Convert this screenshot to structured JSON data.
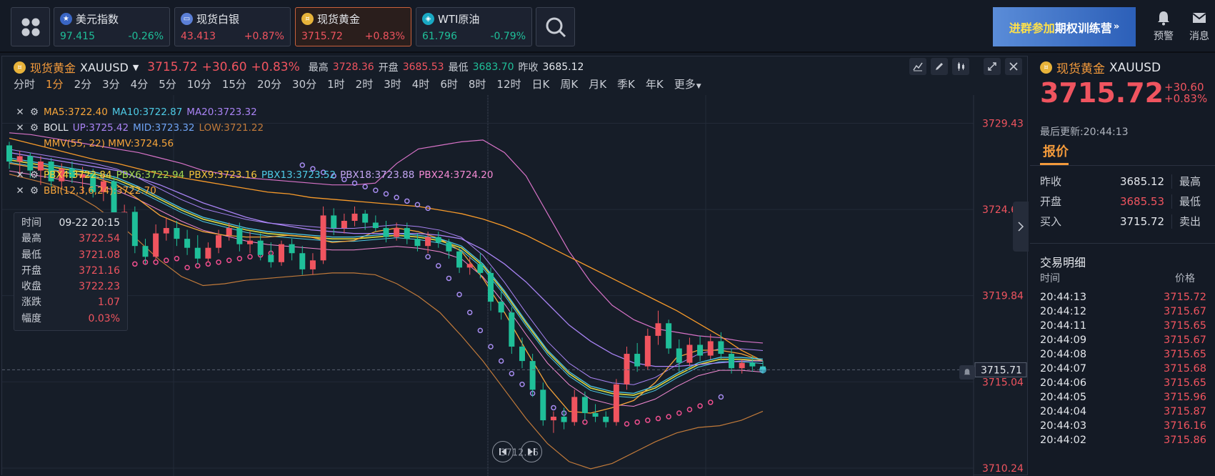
{
  "topbar": {
    "quotes": [
      {
        "name": "美元指数",
        "price": "97.415",
        "change": "-0.26%",
        "price_color": "#1fbf99",
        "change_color": "#1fbf99",
        "icon": "us-flag-icon"
      },
      {
        "name": "现货白银",
        "price": "43.413",
        "change": "+0.87%",
        "price_color": "#f0545f",
        "change_color": "#f0545f",
        "icon": "silver-bar-icon"
      },
      {
        "name": "现货黄金",
        "price": "3715.72",
        "change": "+0.83%",
        "price_color": "#f0545f",
        "change_color": "#f0545f",
        "icon": "gold-coin-icon"
      },
      {
        "name": "WTI原油",
        "price": "61.796",
        "change": "-0.79%",
        "price_color": "#1fbf99",
        "change_color": "#1fbf99",
        "icon": "oil-drum-icon"
      }
    ],
    "banner_part1": "进群参加",
    "banner_part2": "期权训练营",
    "banner_arrow": "»",
    "alert_label": "预警",
    "message_label": "消息"
  },
  "chart_header": {
    "name": "现货黄金",
    "symbol": "XAUUSD",
    "price": "3715.72",
    "change": "+30.60",
    "change_pct": "+0.83%",
    "high_label": "最高",
    "high": "3728.36",
    "open_label": "开盘",
    "open": "3685.53",
    "low_label": "最低",
    "low": "3683.70",
    "prev_label": "昨收",
    "prev": "3685.12"
  },
  "periods": [
    "分时",
    "1分",
    "2分",
    "3分",
    "4分",
    "5分",
    "10分",
    "15分",
    "20分",
    "30分",
    "1时",
    "2时",
    "3时",
    "4时",
    "6时",
    "8时",
    "12时",
    "日K",
    "周K",
    "月K",
    "季K",
    "年K",
    "更多"
  ],
  "active_period": "1分",
  "indicators": {
    "ma5": "MA5:3722.40",
    "ma10": "MA10:3722.87",
    "ma20": "MA20:3723.32",
    "boll": "BOLL",
    "boll_up": "UP:3725.42",
    "boll_mid": "MID:3723.32",
    "boll_low": "LOW:3721.22",
    "mmv": "MMV(55, 22) MMV:3724.56",
    "pbx4": "PBX4:3722.84",
    "pbx6": "PBX6:3722.94",
    "pbx9": "PBX9:3723.16",
    "pbx13": "PBX13:3723.52",
    "pbx18": "PBX18:3723.88",
    "pbx24": "PBX24:3724.20",
    "bbi": "BBI(12,3,6,24):3722.70"
  },
  "tooltip": {
    "time_label": "时间",
    "time": "09-22 20:15",
    "high_label": "最高",
    "high": "3722.54",
    "low_label": "最低",
    "low": "3721.08",
    "open_label": "开盘",
    "open": "3721.16",
    "close_label": "收盘",
    "close": "3722.23",
    "change_label": "涨跌",
    "change": "1.07",
    "amp_label": "幅度",
    "amp": "0.03%"
  },
  "chart_data": {
    "type": "candlestick",
    "y_axis_labels": [
      "3729.43",
      "3724.63",
      "3719.84",
      "3715.04",
      "3710.24"
    ],
    "ylim": [
      3709.8,
      3731.0
    ],
    "current_price_label": "3715.71",
    "min_label": "3712.16",
    "candles": [
      [
        3728.2,
        3728.4,
        3726.9,
        3727.3
      ],
      [
        3727.3,
        3727.9,
        3726.5,
        3727.6
      ],
      [
        3727.6,
        3727.8,
        3726.4,
        3726.8
      ],
      [
        3726.8,
        3727.6,
        3726.0,
        3727.3
      ],
      [
        3727.3,
        3727.5,
        3725.9,
        3726.2
      ],
      [
        3726.2,
        3727.2,
        3725.8,
        3726.9
      ],
      [
        3726.9,
        3727.3,
        3726.1,
        3726.4
      ],
      [
        3726.4,
        3727.0,
        3725.5,
        3726.6
      ],
      [
        3726.6,
        3726.9,
        3725.3,
        3725.6
      ],
      [
        3725.6,
        3726.6,
        3725.1,
        3726.2
      ],
      [
        3726.2,
        3726.5,
        3722.6,
        3723.1
      ],
      [
        3723.1,
        3724.9,
        3722.4,
        3724.5
      ],
      [
        3724.5,
        3724.8,
        3722.2,
        3722.6
      ],
      [
        3722.6,
        3723.0,
        3721.6,
        3722.0
      ],
      [
        3722.0,
        3723.8,
        3721.8,
        3723.3
      ],
      [
        3723.3,
        3724.2,
        3722.9,
        3723.6
      ],
      [
        3723.6,
        3724.0,
        3722.6,
        3723.0
      ],
      [
        3723.0,
        3723.5,
        3722.1,
        3722.5
      ],
      [
        3722.5,
        3723.2,
        3721.6,
        3721.9
      ],
      [
        3721.9,
        3722.8,
        3721.7,
        3722.5
      ],
      [
        3722.5,
        3723.5,
        3722.2,
        3723.2
      ],
      [
        3723.2,
        3723.9,
        3722.9,
        3723.6
      ],
      [
        3723.6,
        3723.9,
        3722.3,
        3722.7
      ],
      [
        3722.7,
        3723.4,
        3722.2,
        3722.9
      ],
      [
        3722.9,
        3723.3,
        3721.8,
        3722.1
      ],
      [
        3722.1,
        3722.8,
        3721.4,
        3721.7
      ],
      [
        3721.7,
        3722.9,
        3721.5,
        3722.7
      ],
      [
        3722.7,
        3723.0,
        3721.8,
        3722.2
      ],
      [
        3722.2,
        3722.6,
        3721.0,
        3721.3
      ],
      [
        3721.3,
        3722.2,
        3721.0,
        3721.8
      ],
      [
        3721.8,
        3724.8,
        3721.6,
        3724.3
      ],
      [
        3724.3,
        3724.7,
        3723.2,
        3723.6
      ],
      [
        3723.6,
        3724.4,
        3723.3,
        3724.0
      ],
      [
        3724.0,
        3724.8,
        3723.7,
        3724.4
      ],
      [
        3724.4,
        3724.6,
        3723.5,
        3723.9
      ],
      [
        3723.9,
        3724.3,
        3723.4,
        3723.6
      ],
      [
        3723.6,
        3724.0,
        3722.8,
        3723.1
      ],
      [
        3723.1,
        3723.9,
        3722.9,
        3723.6
      ],
      [
        3723.6,
        3723.9,
        3722.7,
        3723.0
      ],
      [
        3723.0,
        3723.3,
        3722.3,
        3722.6
      ],
      [
        3722.6,
        3723.4,
        3722.2,
        3723.1
      ],
      [
        3723.1,
        3723.4,
        3722.5,
        3722.8
      ],
      [
        3722.8,
        3723.0,
        3721.9,
        3722.3
      ],
      [
        3722.3,
        3722.5,
        3721.1,
        3721.4
      ],
      [
        3721.4,
        3722.0,
        3721.0,
        3721.6
      ],
      [
        3721.6,
        3722.2,
        3720.8,
        3721.1
      ],
      [
        3721.1,
        3721.4,
        3719.0,
        3719.5
      ],
      [
        3719.5,
        3720.2,
        3718.5,
        3718.9
      ],
      [
        3718.9,
        3719.2,
        3716.6,
        3717.0
      ],
      [
        3717.0,
        3717.5,
        3715.8,
        3716.2
      ],
      [
        3716.2,
        3716.6,
        3714.2,
        3714.6
      ],
      [
        3714.6,
        3715.0,
        3712.6,
        3712.9
      ],
      [
        3712.9,
        3713.4,
        3712.2,
        3713.1
      ],
      [
        3713.1,
        3713.6,
        3712.4,
        3712.8
      ],
      [
        3712.8,
        3714.6,
        3712.6,
        3714.2
      ],
      [
        3714.2,
        3714.5,
        3712.9,
        3713.3
      ],
      [
        3713.3,
        3713.8,
        3712.8,
        3713.1
      ],
      [
        3713.1,
        3713.4,
        3712.5,
        3712.8
      ],
      [
        3712.8,
        3715.2,
        3712.6,
        3714.9
      ],
      [
        3714.9,
        3717.0,
        3714.6,
        3716.6
      ],
      [
        3716.6,
        3717.2,
        3715.6,
        3715.9
      ],
      [
        3715.9,
        3718.0,
        3715.7,
        3717.6
      ],
      [
        3717.6,
        3719.0,
        3717.1,
        3718.3
      ],
      [
        3718.3,
        3718.5,
        3716.6,
        3716.9
      ],
      [
        3716.9,
        3717.4,
        3715.6,
        3716.1
      ],
      [
        3716.1,
        3717.5,
        3715.9,
        3717.1
      ],
      [
        3717.1,
        3717.6,
        3716.2,
        3716.5
      ],
      [
        3716.5,
        3717.7,
        3716.3,
        3717.3
      ],
      [
        3717.3,
        3717.8,
        3716.3,
        3716.6
      ],
      [
        3716.6,
        3716.9,
        3715.5,
        3715.8
      ],
      [
        3715.8,
        3716.3,
        3715.5,
        3716.1
      ],
      [
        3716.1,
        3716.5,
        3715.6,
        3715.9
      ],
      [
        3715.9,
        3716.2,
        3715.5,
        3715.72
      ]
    ],
    "ma_series": [
      {
        "name": "MA5",
        "color": "#f7a53a",
        "values": [
          3727.2,
          3727.0,
          3726.8,
          3726.6,
          3726.4,
          3726.0,
          3725.2,
          3724.3,
          3723.8,
          3723.4,
          3723.2,
          3723.1,
          3723.1,
          3723.2,
          3723.1,
          3722.8,
          3722.9,
          3723.4,
          3723.6,
          3723.4,
          3723.0,
          3722.3,
          3720.8,
          3718.9,
          3716.8,
          3714.8,
          3713.4,
          3713.3,
          3713.6,
          3714.0,
          3715.0,
          3716.4,
          3716.8,
          3716.8,
          3716.6,
          3716.2
        ]
      },
      {
        "name": "MA10",
        "color": "#4ecbe6",
        "values": [
          3727.5,
          3727.3,
          3727.1,
          3726.9,
          3726.7,
          3726.4,
          3725.9,
          3725.3,
          3724.7,
          3724.2,
          3723.9,
          3723.6,
          3723.4,
          3723.3,
          3723.2,
          3723.1,
          3723.1,
          3723.2,
          3723.3,
          3723.2,
          3723.0,
          3722.6,
          3721.6,
          3720.1,
          3718.4,
          3716.8,
          3715.6,
          3714.8,
          3714.5,
          3714.4,
          3714.8,
          3715.5,
          3716.1,
          3716.4,
          3716.4,
          3716.3
        ]
      },
      {
        "name": "MA20",
        "color": "#a983f4",
        "values": [
          3727.8,
          3727.6,
          3727.4,
          3727.2,
          3727.0,
          3726.8,
          3726.4,
          3726.0,
          3725.5,
          3725.0,
          3724.6,
          3724.2,
          3723.9,
          3723.7,
          3723.5,
          3723.4,
          3723.3,
          3723.3,
          3723.3,
          3723.3,
          3723.2,
          3723.0,
          3722.4,
          3721.6,
          3720.6,
          3719.4,
          3718.2,
          3717.3,
          3716.6,
          3716.1,
          3715.9,
          3715.9,
          3716.0,
          3716.1,
          3716.2,
          3716.2
        ]
      }
    ],
    "boll_bands": {
      "up": [
        3728.9,
        3728.8,
        3728.6,
        3728.4,
        3728.2,
        3728.0,
        3727.8,
        3727.5,
        3727.2,
        3726.8,
        3726.6,
        3726.4,
        3726.3,
        3726.2,
        3726.1,
        3726.0,
        3726.0,
        3726.1,
        3727.2,
        3728.0,
        3728.2,
        3728.4,
        3728.5,
        3727.8,
        3726.5,
        3724.4,
        3722.3,
        3720.6,
        3719.3,
        3718.5,
        3718.0,
        3717.8,
        3717.6,
        3717.5,
        3717.3,
        3717.2
      ],
      "low": [
        3726.6,
        3726.3,
        3726.0,
        3725.5,
        3724.8,
        3723.9,
        3722.9,
        3721.8,
        3720.9,
        3720.4,
        3720.5,
        3720.7,
        3720.8,
        3720.9,
        3721.0,
        3721.1,
        3721.1,
        3721.0,
        3720.5,
        3719.8,
        3718.9,
        3717.6,
        3716.2,
        3714.6,
        3713.0,
        3711.6,
        3710.6,
        3710.2,
        3710.5,
        3711.1,
        3711.7,
        3712.2,
        3712.5,
        3712.6,
        3712.9,
        3713.4
      ]
    },
    "mmv_series": [
      3728.6,
      3728.3,
      3728.0,
      3727.7,
      3727.4,
      3727.2,
      3726.9,
      3726.6,
      3726.4,
      3726.2,
      3726.0,
      3725.8,
      3725.6,
      3725.5,
      3725.3,
      3725.2,
      3725.1,
      3725.0,
      3724.9,
      3724.8,
      3724.6,
      3724.4,
      3724.1,
      3723.7,
      3723.2,
      3722.6,
      3722.0,
      3721.4,
      3720.8,
      3720.2,
      3719.6,
      3719.0,
      3718.3,
      3717.6,
      3716.8,
      3716.2
    ],
    "sar_points": [
      [
        28,
        3727.1
      ],
      [
        29,
        3726.9
      ],
      [
        30,
        3726.7
      ],
      [
        31,
        3726.5
      ],
      [
        32,
        3726.3
      ],
      [
        33,
        3726.1
      ],
      [
        34,
        3725.9
      ],
      [
        35,
        3725.7
      ],
      [
        36,
        3725.5
      ],
      [
        37,
        3725.3
      ],
      [
        38,
        3725.1
      ],
      [
        39,
        3724.9
      ],
      [
        40,
        3724.7
      ],
      [
        11,
        3721.6
      ],
      [
        12,
        3721.6
      ],
      [
        13,
        3721.7
      ],
      [
        14,
        3721.7
      ],
      [
        15,
        3721.8
      ],
      [
        16,
        3721.9
      ],
      [
        17,
        3721.4
      ],
      [
        18,
        3721.5
      ],
      [
        19,
        3721.6
      ],
      [
        20,
        3721.7
      ],
      [
        21,
        3721.8
      ],
      [
        22,
        3721.9
      ],
      [
        23,
        3722.0
      ],
      [
        24,
        3722.1
      ],
      [
        25,
        3722.2
      ],
      [
        26,
        3722.3
      ],
      [
        27,
        3722.4
      ],
      [
        40,
        3722.0
      ],
      [
        41,
        3721.5
      ],
      [
        42,
        3720.8
      ],
      [
        43,
        3719.9
      ],
      [
        44,
        3718.9
      ],
      [
        45,
        3717.9
      ],
      [
        46,
        3717.0
      ],
      [
        47,
        3716.2
      ],
      [
        48,
        3715.5
      ],
      [
        49,
        3714.9
      ],
      [
        50,
        3714.4
      ],
      [
        51,
        3714.0
      ],
      [
        52,
        3713.6
      ],
      [
        53,
        3713.3
      ],
      [
        54,
        3713.0
      ],
      [
        55,
        3712.8
      ],
      [
        59,
        3712.7
      ],
      [
        60,
        3712.8
      ],
      [
        61,
        3712.9
      ],
      [
        62,
        3713.0
      ],
      [
        63,
        3713.1
      ],
      [
        64,
        3713.3
      ],
      [
        65,
        3713.5
      ],
      [
        66,
        3713.7
      ],
      [
        67,
        3713.9
      ],
      [
        68,
        3714.2
      ]
    ]
  },
  "right_panel": {
    "name": "现货黄金",
    "symbol": "XAUUSD",
    "price": "3715.72",
    "change": "+30.60",
    "change_pct": "+0.83%",
    "updated": "最后更新:20:44:13",
    "tab_quote": "报价",
    "stats": [
      {
        "l1": "昨收",
        "v1": "3685.12",
        "c1": "#e4e7ec",
        "l2": "最高"
      },
      {
        "l1": "开盘",
        "v1": "3685.53",
        "c1": "#f0545f",
        "l2": "最低"
      },
      {
        "l1": "买入",
        "v1": "3715.72",
        "c1": "#e4e7ec",
        "l2": "卖出"
      }
    ],
    "trades_title": "交易明细",
    "col_time": "时间",
    "col_price": "价格",
    "trades": [
      {
        "t": "20:44:13",
        "p": "3715.72"
      },
      {
        "t": "20:44:12",
        "p": "3715.67"
      },
      {
        "t": "20:44:11",
        "p": "3715.65"
      },
      {
        "t": "20:44:09",
        "p": "3715.67"
      },
      {
        "t": "20:44:08",
        "p": "3715.65"
      },
      {
        "t": "20:44:07",
        "p": "3715.68"
      },
      {
        "t": "20:44:06",
        "p": "3715.65"
      },
      {
        "t": "20:44:05",
        "p": "3715.96"
      },
      {
        "t": "20:44:04",
        "p": "3715.87"
      },
      {
        "t": "20:44:03",
        "p": "3716.16"
      },
      {
        "t": "20:44:02",
        "p": "3715.86"
      }
    ]
  }
}
